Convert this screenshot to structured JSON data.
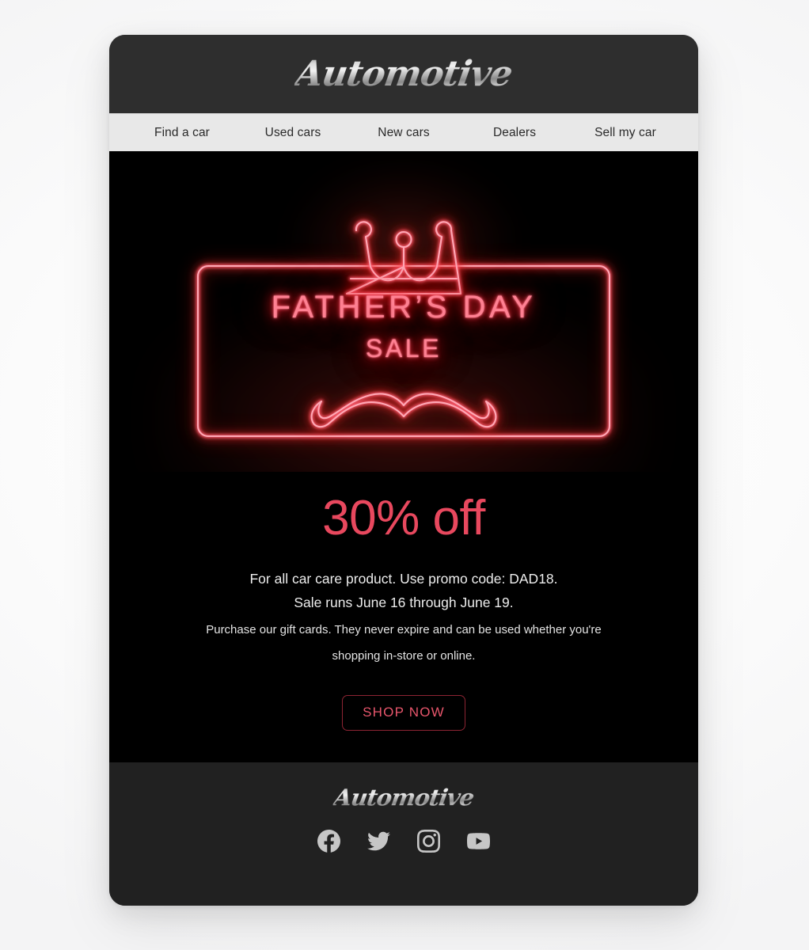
{
  "page": {
    "background_color": "#fafafa"
  },
  "card": {
    "background_color": "#2b2b2b",
    "hero_background_color": "#000000",
    "footer_background_color": "#212121"
  },
  "header": {
    "brand": "Automotive",
    "background_color": "#2e2e2e"
  },
  "nav": {
    "background_color": "#e8e8e8",
    "text_color": "#2a2a2a",
    "items": [
      {
        "label": "Find a car"
      },
      {
        "label": "Used cars"
      },
      {
        "label": "New cars"
      },
      {
        "label": "Dealers"
      },
      {
        "label": "Sell my car"
      }
    ]
  },
  "hero": {
    "neon_sign": {
      "crown_icon": "crown-icon",
      "mustache_icon": "mustache-icon",
      "frame_icon": "neon-frame",
      "line1": "FATHER’S DAY",
      "line2": "SALE",
      "neon_core_color": "#ff8092",
      "neon_glow_color": "#ff1f33"
    },
    "offer": {
      "headline": "30% off",
      "headline_color": "#e8485e",
      "lines": [
        "For all car care product. Use promo code: DAD18.",
        "Sale runs June 16 through June 19.",
        "Purchase our gift cards. They never expire and can be used whether you're",
        "shopping in-store or online."
      ]
    },
    "cta": {
      "label": "SHOP NOW",
      "text_color": "#e8566c",
      "border_color": "#8d2433"
    }
  },
  "footer": {
    "brand": "Automotive",
    "social": [
      {
        "name": "facebook-icon",
        "label": "Facebook"
      },
      {
        "name": "twitter-icon",
        "label": "Twitter"
      },
      {
        "name": "instagram-icon",
        "label": "Instagram"
      },
      {
        "name": "youtube-icon",
        "label": "YouTube"
      }
    ]
  }
}
